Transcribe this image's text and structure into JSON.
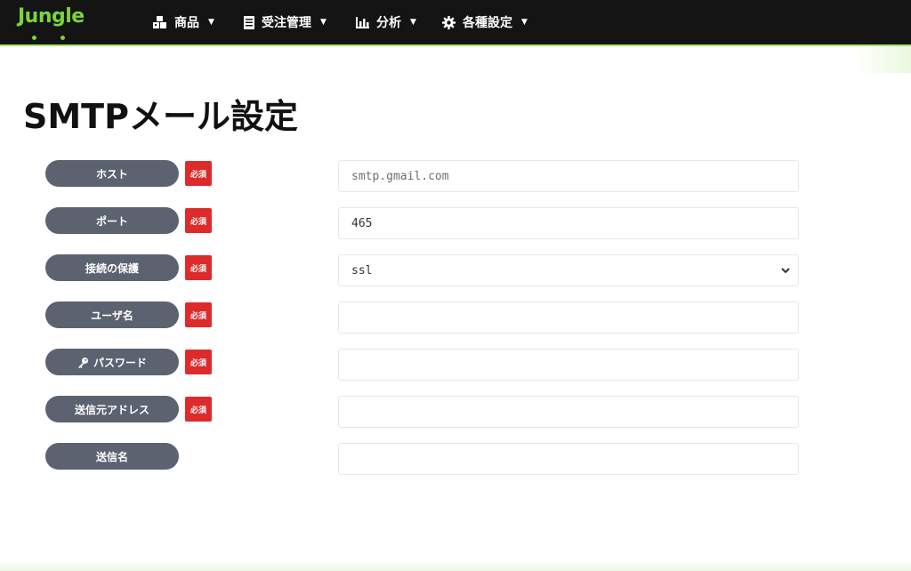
{
  "brand": {
    "name": "Jungle",
    "color": "#7bd33c"
  },
  "nav": {
    "items": [
      {
        "label": "商品",
        "icon": "boxes-icon"
      },
      {
        "label": "受注管理",
        "icon": "document-icon"
      },
      {
        "label": "分析",
        "icon": "bar-chart-icon"
      },
      {
        "label": "各種設定",
        "icon": "gear-icon"
      }
    ]
  },
  "page": {
    "title": "SMTPメール設定"
  },
  "required_badge": "必須",
  "form": {
    "host": {
      "label": "ホスト",
      "placeholder": "smtp.gmail.com",
      "value": ""
    },
    "port": {
      "label": "ポート",
      "value": "465"
    },
    "security": {
      "label": "接続の保護",
      "value": "ssl"
    },
    "username": {
      "label": "ユーザ名",
      "value": ""
    },
    "password": {
      "label": "パスワード",
      "icon": "key-icon",
      "value": ""
    },
    "from_address": {
      "label": "送信元アドレス",
      "value": ""
    },
    "from_name": {
      "label": "送信名",
      "value": ""
    }
  },
  "colors": {
    "navbar_bg": "#141414",
    "pill_bg": "#5b6270",
    "required_bg": "#dd2b2b"
  }
}
